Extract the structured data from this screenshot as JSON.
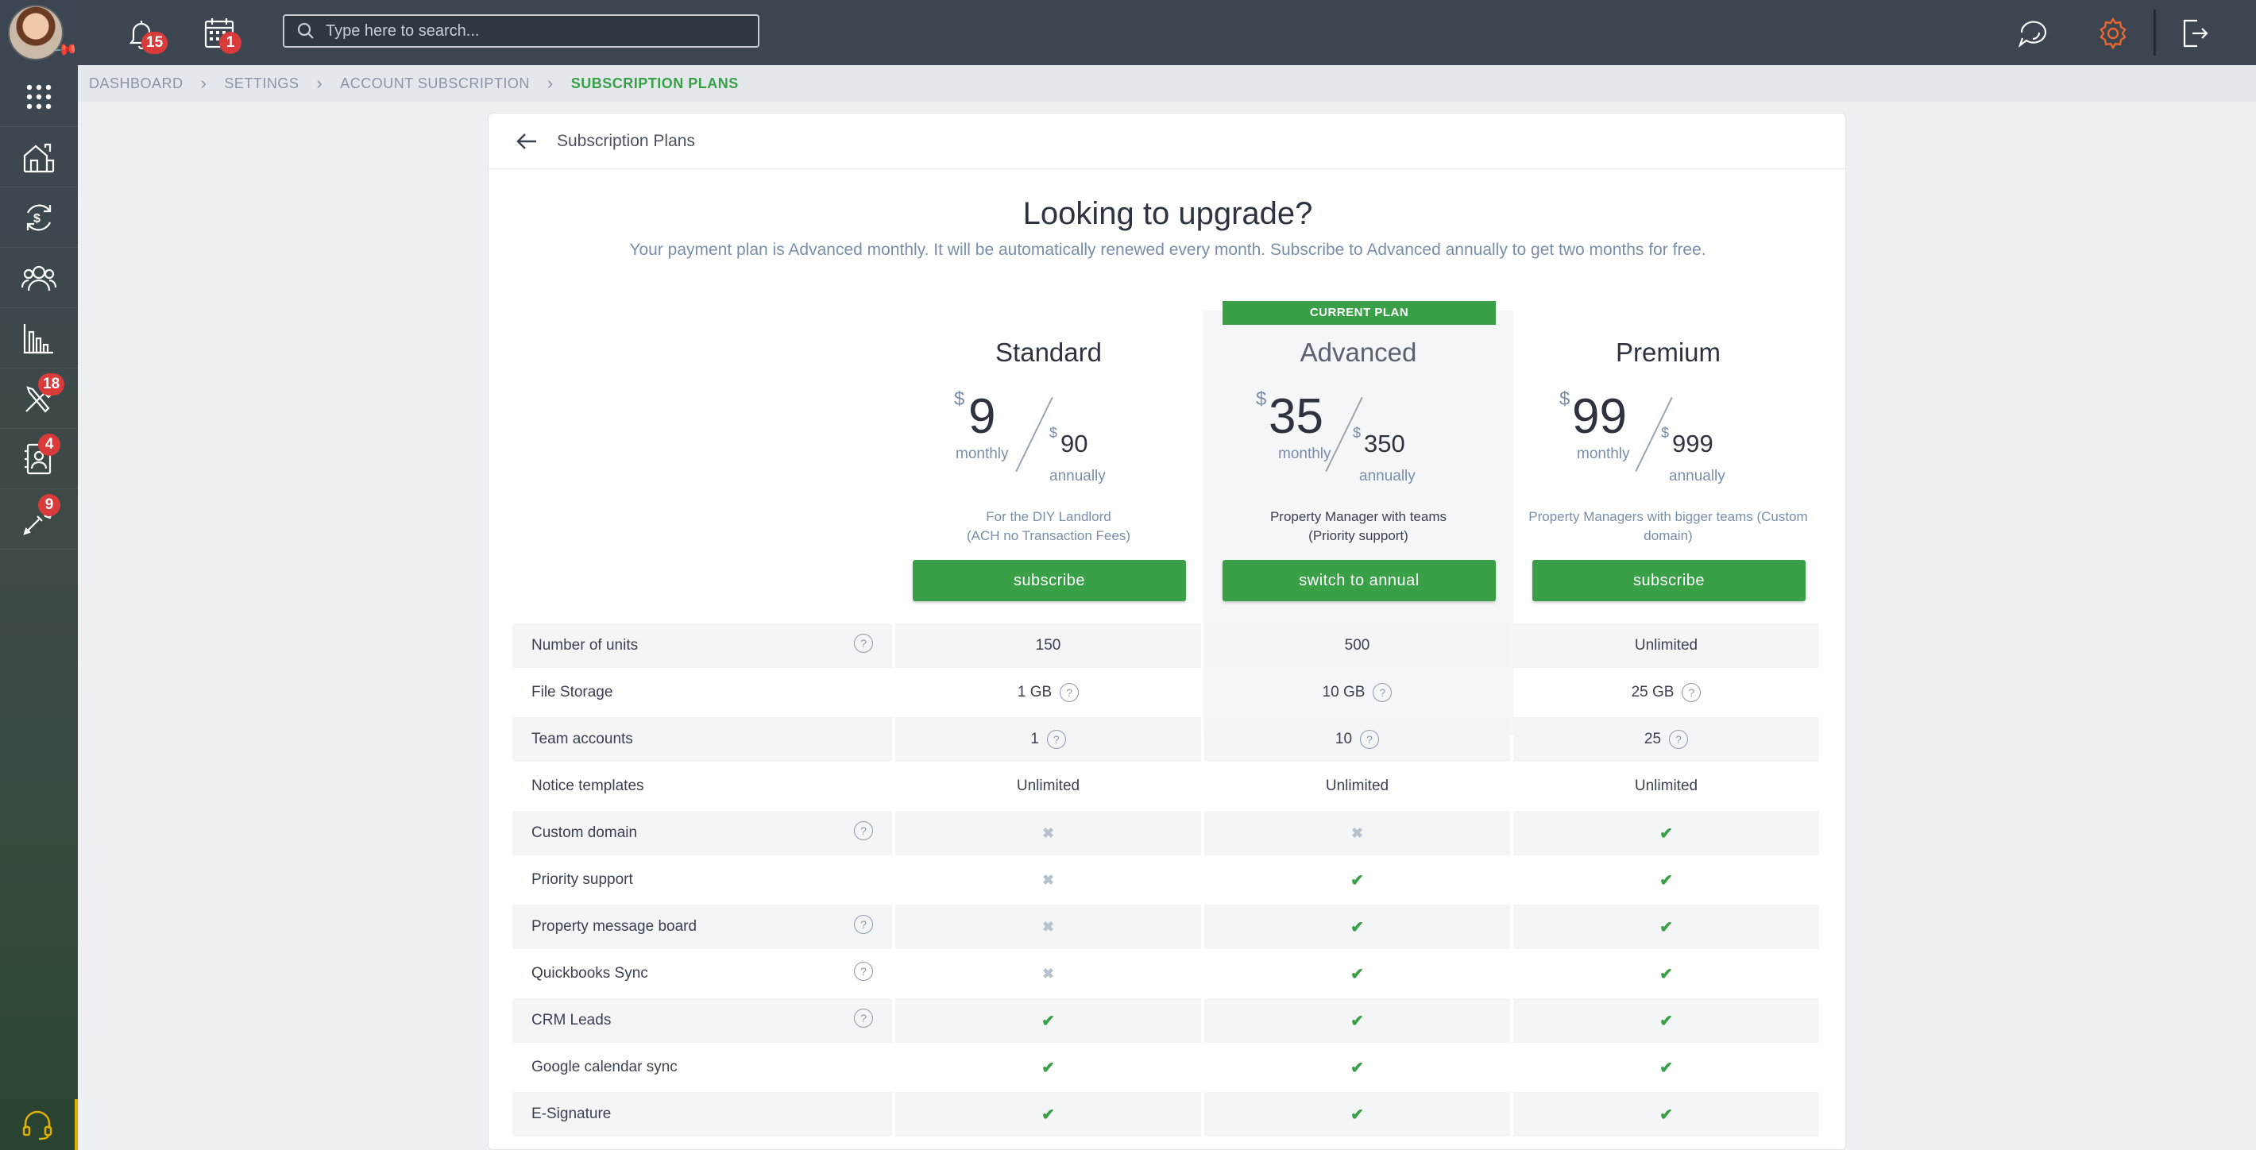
{
  "topbar": {
    "notifications_count": "15",
    "calendar_count": "1",
    "search_placeholder": "Type here to search..."
  },
  "sidebar": {
    "items": [
      {
        "name": "apps-grid-icon",
        "badge": ""
      },
      {
        "name": "properties-icon",
        "badge": ""
      },
      {
        "name": "payments-icon",
        "badge": ""
      },
      {
        "name": "people-icon",
        "badge": ""
      },
      {
        "name": "reports-icon",
        "badge": ""
      },
      {
        "name": "maintenance-icon",
        "badge": "18"
      },
      {
        "name": "contacts-icon",
        "badge": "4"
      },
      {
        "name": "tools-icon",
        "badge": "9"
      }
    ]
  },
  "breadcrumb": [
    "DASHBOARD",
    "SETTINGS",
    "ACCOUNT SUBSCRIPTION",
    "SUBSCRIPTION PLANS"
  ],
  "page": {
    "title": "Subscription Plans",
    "headline": "Looking to upgrade?",
    "subline": "Your payment plan is Advanced monthly. It will be automatically renewed every month. Subscribe to Advanced annually to get two months for free."
  },
  "plans": [
    {
      "name": "Standard",
      "currency": "$",
      "monthly": "9",
      "annually": "90",
      "monthly_label": "monthly",
      "annually_label": "annually",
      "desc1": "For the DIY Landlord",
      "desc2": "(ACH no Transaction Fees)",
      "button": "subscribe",
      "badge": ""
    },
    {
      "name": "Advanced",
      "currency": "$",
      "monthly": "35",
      "annually": "350",
      "monthly_label": "monthly",
      "annually_label": "annually",
      "desc1": "Property Manager with teams",
      "desc2": "(Priority support)",
      "button": "switch to annual",
      "badge": "CURRENT PLAN"
    },
    {
      "name": "Premium",
      "currency": "$",
      "monthly": "99",
      "annually": "999",
      "monthly_label": "monthly",
      "annually_label": "annually",
      "desc1": "Property Managers with bigger teams (Custom",
      "desc2": "domain)",
      "button": "subscribe",
      "badge": ""
    }
  ],
  "features": [
    {
      "label": "Number of units",
      "help": true,
      "values": [
        "150",
        "500",
        "Unlimited"
      ]
    },
    {
      "label": "File Storage",
      "help": false,
      "values": [
        "1 GB",
        "10 GB",
        "25 GB"
      ]
    },
    {
      "label": "Team accounts",
      "help": false,
      "values": [
        "1",
        "10",
        "25"
      ]
    },
    {
      "label": "Notice templates",
      "help": false,
      "values": [
        "Unlimited",
        "Unlimited",
        "Unlimited"
      ]
    },
    {
      "label": "Custom domain",
      "help": true,
      "values": [
        "✖",
        "✖",
        "✔"
      ]
    },
    {
      "label": "Priority support",
      "help": false,
      "values": [
        "✖",
        "✔",
        "✔"
      ]
    },
    {
      "label": "Property message board",
      "help": true,
      "values": [
        "✖",
        "✔",
        "✔"
      ]
    },
    {
      "label": "Quickbooks Sync",
      "help": true,
      "values": [
        "✖",
        "✔",
        "✔"
      ]
    },
    {
      "label": "CRM Leads",
      "help": true,
      "values": [
        "✔",
        "✔",
        "✔"
      ]
    },
    {
      "label": "Google calendar sync",
      "help": false,
      "values": [
        "✔",
        "✔",
        "✔"
      ]
    },
    {
      "label": "E-Signature",
      "help": false,
      "values": [
        "✔",
        "✔",
        "✔"
      ]
    }
  ],
  "colors": {
    "accent": "#3aa047",
    "topbar": "#3c4550",
    "badge": "#d93b3b",
    "settings": "#e8672f"
  }
}
